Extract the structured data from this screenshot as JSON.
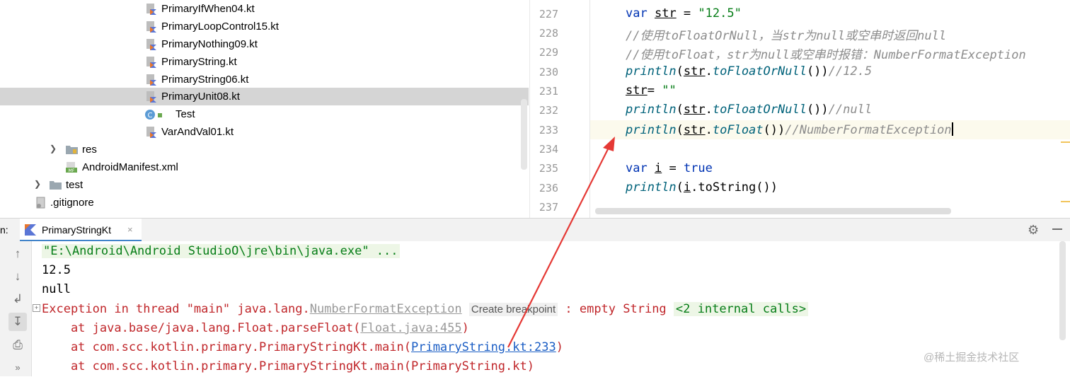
{
  "project_tree": {
    "items": [
      {
        "label": "PrimaryIfWhen04.kt",
        "type": "kotlin-file"
      },
      {
        "label": "PrimaryLoopControl15.kt",
        "type": "kotlin-file"
      },
      {
        "label": "PrimaryNothing09.kt",
        "type": "kotlin-file"
      },
      {
        "label": "PrimaryString.kt",
        "type": "kotlin-file"
      },
      {
        "label": "PrimaryString06.kt",
        "type": "kotlin-file"
      },
      {
        "label": "PrimaryUnit08.kt",
        "type": "kotlin-file",
        "selected": true
      },
      {
        "label": "Test",
        "type": "class"
      },
      {
        "label": "VarAndVal01.kt",
        "type": "kotlin-file"
      },
      {
        "label": "res",
        "type": "folder"
      },
      {
        "label": "AndroidManifest.xml",
        "type": "manifest"
      },
      {
        "label": "test",
        "type": "folder"
      },
      {
        "label": ".gitignore",
        "type": "file"
      }
    ]
  },
  "editor": {
    "line_numbers": [
      "227",
      "228",
      "229",
      "230",
      "231",
      "232",
      "233",
      "234",
      "235",
      "236",
      "237"
    ],
    "current_line": "233",
    "lines": {
      "l227": {
        "kw": "var",
        "name": "str",
        "op": " = ",
        "str": "\"12.5\""
      },
      "l228": {
        "comment": "//使用toFloatOrNull，当str为null或空串时返回null"
      },
      "l229": {
        "comment": "//使用toFloat，str为null或空串时报错：NumberFormatException"
      },
      "l230": {
        "fn": "println",
        "p1": "(",
        "recv": "str",
        "dot": ".",
        "call": "toFloatOrNull",
        "p2": "())",
        "comment": "//12.5"
      },
      "l231": {
        "name": "str",
        "op": "= ",
        "str": "\"\""
      },
      "l232": {
        "fn": "println",
        "p1": "(",
        "recv": "str",
        "dot": ".",
        "call": "toFloatOrNull",
        "p2": "())",
        "comment": "//null"
      },
      "l233": {
        "fn": "println",
        "p1": "(",
        "recv": "str",
        "dot": ".",
        "call": "toFloat",
        "p2": "())",
        "comment": "//NumberFormatException"
      },
      "l235": {
        "kw": "var",
        "name": "i",
        "op": " = ",
        "val": "true"
      },
      "l236": {
        "fn": "println",
        "p1": "(",
        "recv": "i",
        "rest": ".toString())"
      }
    }
  },
  "run_panel": {
    "label": "n:",
    "tab_label": "PrimaryStringKt",
    "tab_close": "×",
    "console": {
      "cmd": "\"E:\\Android\\Android StudioO\\jre\\bin\\java.exe\" ...",
      "out1": "12.5",
      "out2": "null",
      "exc_prefix": "Exception in thread \"main\" java.lang.",
      "exc_link": "NumberFormatException",
      "breakpoint": "Create breakpoint",
      "exc_msg": " : empty String ",
      "internal": "<2 internal calls>",
      "st1_prefix": "    at java.base/java.lang.Float.parseFloat(",
      "st1_link": "Float.java:455",
      "st1_suffix": ")",
      "st2_prefix": "    at com.scc.kotlin.primary.PrimaryStringKt.main(",
      "st2_link": "PrimaryString.kt:233",
      "st2_suffix": ")",
      "st3": "    at com.scc.kotlin.primary.PrimaryStringKt.main(PrimaryString.kt)"
    }
  },
  "watermark": "@稀土掘金技术社区",
  "colors": {
    "accent": "#4083c9",
    "error": "#c0262a",
    "keyword": "#0033b3",
    "string": "#067d17",
    "annotation_arrow": "#e53935"
  }
}
